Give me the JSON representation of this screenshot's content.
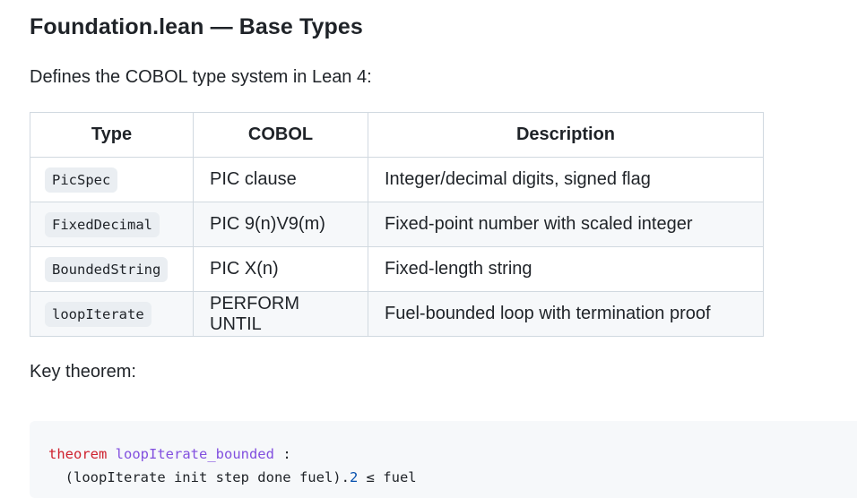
{
  "heading": "Foundation.lean — Base Types",
  "intro": "Defines the COBOL type system in Lean 4:",
  "table": {
    "headers": [
      "Type",
      "COBOL",
      "Description"
    ],
    "rows": [
      {
        "type": "PicSpec",
        "cobol": "PIC clause",
        "description": "Integer/decimal digits, signed flag"
      },
      {
        "type": "FixedDecimal",
        "cobol": "PIC 9(n)V9(m)",
        "description": "Fixed-point number with scaled integer"
      },
      {
        "type": "BoundedString",
        "cobol": "PIC X(n)",
        "description": "Fixed-length string"
      },
      {
        "type": "loopIterate",
        "cobol": "PERFORM UNTIL",
        "description": "Fuel-bounded loop with termination proof"
      }
    ]
  },
  "key_label": "Key theorem:",
  "code": {
    "line1": {
      "keyword": "theorem",
      "space": " ",
      "name": "loopIterate_bounded",
      "rest": " :"
    },
    "line2": {
      "before": "  (loopIterate init step done fuel).",
      "number": "2",
      "after": " ≤ fuel"
    }
  }
}
